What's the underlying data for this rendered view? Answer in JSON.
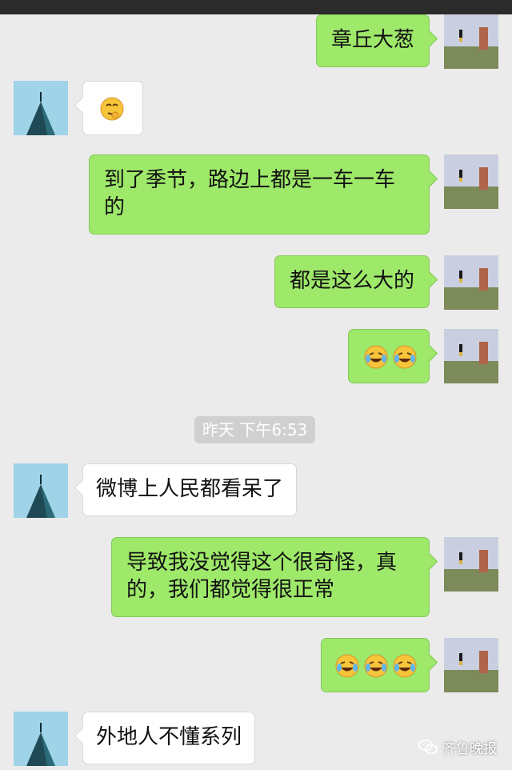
{
  "colors": {
    "background": "#ebebeb",
    "outgoing_bubble": "#9ee86a",
    "incoming_bubble": "#ffffff",
    "timestamp_bg": "#d0d0d0"
  },
  "messages": [
    {
      "direction": "out",
      "text": "章丘大葱"
    },
    {
      "direction": "in",
      "emoji": [
        "thinking-cheek-emoji"
      ]
    },
    {
      "direction": "out",
      "text": "到了季节，路边上都是一车一车的"
    },
    {
      "direction": "out",
      "text": "都是这么大的"
    },
    {
      "direction": "out",
      "emoji": [
        "crying-laughing-emoji",
        "crying-laughing-emoji"
      ]
    },
    {
      "direction": "in",
      "text": "微博上人民都看呆了"
    },
    {
      "direction": "out",
      "text": "导致我没觉得这个很奇怪，真的，我们都觉得很正常"
    },
    {
      "direction": "out",
      "emoji": [
        "crying-laughing-emoji",
        "crying-laughing-emoji",
        "crying-laughing-emoji"
      ]
    },
    {
      "direction": "in",
      "text": "外地人不懂系列"
    }
  ],
  "timestamp": "昨天 下午6:53",
  "watermark": {
    "text": "齐鲁晚报",
    "icon": "wechat-logo-icon"
  }
}
